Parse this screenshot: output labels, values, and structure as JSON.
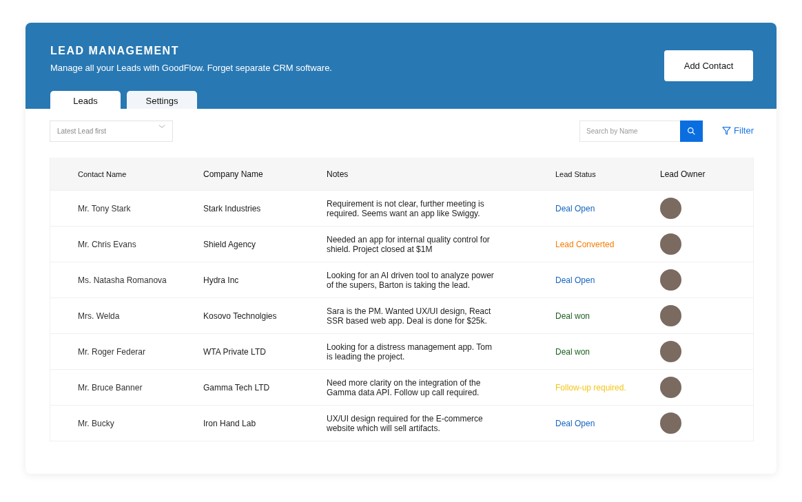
{
  "header": {
    "title": "LEAD MANAGEMENT",
    "subtitle": "Manage all your Leads with GoodFlow. Forget separate CRM software.",
    "action_button": "Add Contact"
  },
  "tabs": [
    {
      "label": "Leads",
      "selected": true
    },
    {
      "label": "Settings",
      "selected": false
    }
  ],
  "sort_dropdown": {
    "value": "Latest Lead first"
  },
  "search": {
    "placeholder": "Search by Name"
  },
  "filter_button": "Filter",
  "table": {
    "columns": [
      "Contact Name",
      "Company Name",
      "Notes",
      "Lead Status",
      "Lead Owner"
    ],
    "rows": [
      {
        "contact": "Mr. Tony Stark",
        "company": "Stark Industries",
        "notes": "Requirement is not clear, further meeting is required. Seems want an app like Swiggy.",
        "status": "Deal Open",
        "color": "#1565c0"
      },
      {
        "contact": "Mr. Chris Evans",
        "company": "Shield Agency",
        "notes": "Needed an app for internal quality control for shield. Project closed at $1M",
        "status": "Lead Converted",
        "color": "#f57c00"
      },
      {
        "contact": "Ms. Natasha Romanova",
        "company": "Hydra Inc",
        "notes": "Looking for an AI driven tool to analyze power of the supers, Barton is taking the lead.",
        "status": "Deal Open",
        "color": "#1565c0"
      },
      {
        "contact": "Mrs. Welda",
        "company": "Kosovo Technolgies",
        "notes": "Sara is the PM. Wanted UX/UI design, React SSR based web app. Deal is done for $25k.",
        "status": "Deal won",
        "color": "#1b5e20"
      },
      {
        "contact": "Mr. Roger Federar",
        "company": "WTA Private LTD",
        "notes": "Looking for a distress management app. Tom is leading the project.",
        "status": "Deal won",
        "color": "#1b5e20"
      },
      {
        "contact": "Mr. Bruce Banner",
        "company": "Gamma Tech LTD",
        "notes": "Need more clarity on the integration of the Gamma data API. Follow up call required.",
        "status": "Follow-up required.",
        "color": "#f5c518"
      },
      {
        "contact": "Mr. Bucky",
        "company": "Iron Hand Lab",
        "notes": "UX/UI design required for the E-commerce website which will sell artifacts.",
        "status": "Deal Open",
        "color": "#1565c0"
      }
    ]
  }
}
